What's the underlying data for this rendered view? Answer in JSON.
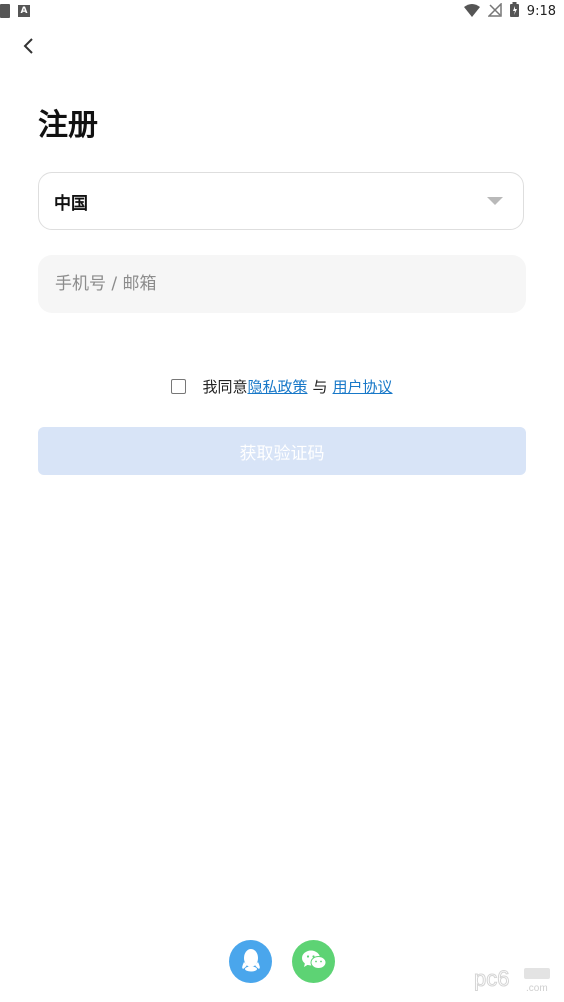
{
  "status_bar": {
    "time": "9:18",
    "left_icons": [
      "sim-card-icon",
      "a-notification-icon"
    ],
    "right_icons": [
      "wifi-icon",
      "no-signal-icon",
      "battery-icon"
    ],
    "a_glyph": "A"
  },
  "header": {
    "back_icon": "chevron-left-icon",
    "title": "注册"
  },
  "form": {
    "country_label": "中国",
    "phone_placeholder": "手机号 / 邮箱",
    "phone_value": ""
  },
  "agreement": {
    "prefix": "我同意",
    "privacy_link": "隐私政策",
    "conjunction": "与",
    "terms_link": "用户协议",
    "checked": false
  },
  "submit_button": {
    "label": "获取验证码"
  },
  "social_login": {
    "icons": [
      "qq-icon",
      "wechat-icon"
    ]
  },
  "colors": {
    "accent_link": "#1878c8",
    "button_disabled_bg": "#d8e4f7",
    "qq_blue": "#4aa6ec",
    "wechat_green": "#5dd374",
    "input_bg": "#f6f6f6"
  }
}
